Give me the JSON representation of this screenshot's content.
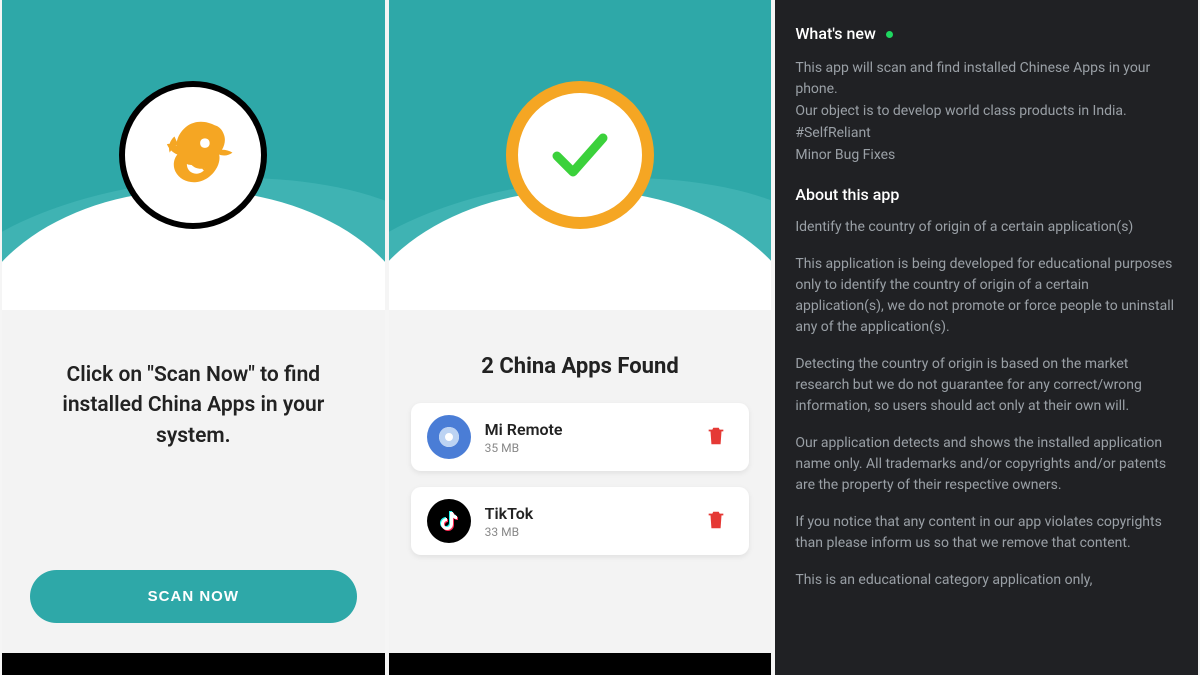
{
  "panel1": {
    "intro": "Click on \"Scan Now\" to find installed China Apps in your system.",
    "scan_button": "SCAN NOW"
  },
  "panel2": {
    "title": "2 China Apps Found",
    "apps": [
      {
        "name": "Mi Remote",
        "size": "35 MB",
        "icon": "mi-remote-icon"
      },
      {
        "name": "TikTok",
        "size": "33 MB",
        "icon": "tiktok-icon"
      }
    ]
  },
  "panel3": {
    "whats_new_header": "What's new",
    "whats_new_lines": {
      "l1": "This app will scan and find installed Chinese Apps in your phone.",
      "l2": "Our object is to develop world class products in India.",
      "l3": "#SelfReliant",
      "l4": "Minor Bug Fixes"
    },
    "about_header": "About this app",
    "about_tagline": "Identify the country of origin of a certain application(s)",
    "about_p1": "This application is being developed for educational purposes only to identify the country of origin of a certain application(s), we do not promote or force people to uninstall any of the application(s).",
    "about_p2": "Detecting the country of origin is based on the market research but we do not guarantee for any correct/wrong information, so users should act only at their own will.",
    "about_p3": "Our application detects and shows the installed application name only. All trademarks and/or copyrights and/or patents are the property of their respective owners.",
    "about_p4": "If you notice that any content in our app violates copyrights than please inform us so that we remove that content.",
    "about_p5": "This is an educational category application only,"
  },
  "colors": {
    "teal": "#2ea8a8",
    "accent_orange": "#f5a623",
    "check_green": "#3bd13b",
    "trash_red": "#e53935",
    "dark_bg": "#202124"
  }
}
